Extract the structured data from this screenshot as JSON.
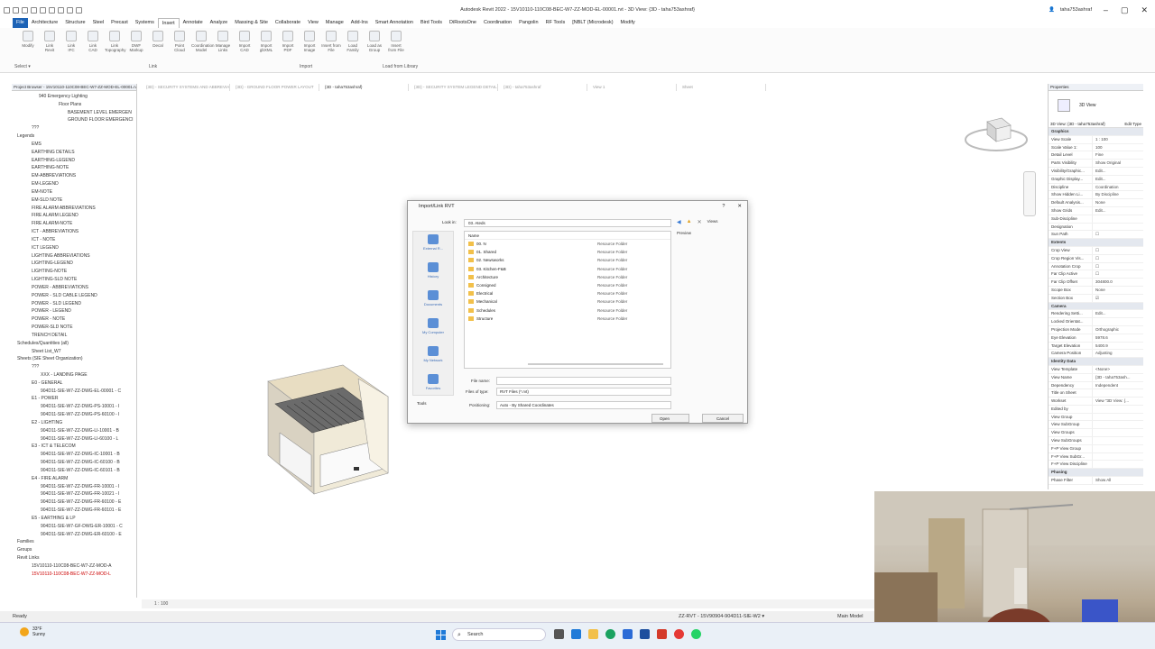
{
  "window": {
    "title": "Autodesk Revit 2022 - 15V10110-110C08-BEC-W7-ZZ-MOD-EL-00001.rvt - 3D View: {3D - taha753ashraf}",
    "user": "taha753ashraf",
    "controls": [
      "–",
      "▢",
      "✕"
    ]
  },
  "tabs": [
    "File",
    "Architecture",
    "Structure",
    "Steel",
    "Precast",
    "Systems",
    "Insert",
    "Annotate",
    "Analyze",
    "Massing & Site",
    "Collaborate",
    "View",
    "Manage",
    "Add-Ins",
    "Smart Annotation",
    "Bird Tools",
    "DiRootsOne",
    "Coordination",
    "Pangolin",
    "RF Tools",
    "[NBLT (Microdesk)",
    "Modify"
  ],
  "active_tab": "Insert",
  "ribbon": {
    "buttons": [
      [
        "Modify",
        ""
      ],
      [
        "Link",
        "Revit"
      ],
      [
        "Link",
        "IFC"
      ],
      [
        "Link",
        "CAD"
      ],
      [
        "Link",
        "Topography"
      ],
      [
        "DWF",
        "Markup"
      ],
      [
        "Decal",
        ""
      ],
      [
        "Point",
        "Cloud"
      ],
      [
        "Coordination",
        "Model"
      ],
      [
        "Manage",
        "Links"
      ],
      [
        "Import",
        "CAD"
      ],
      [
        "Import",
        "gbXML"
      ],
      [
        "Import",
        "PDF"
      ],
      [
        "Import",
        "Image"
      ],
      [
        "Insert from",
        "File"
      ],
      [
        "Load",
        "Family"
      ],
      [
        "Load as",
        "Group"
      ],
      [
        "Insert",
        "from File"
      ]
    ],
    "panels": [
      "Select",
      "Link",
      "Import",
      "Load from Library"
    ],
    "select": "Select ▾"
  },
  "view_tabs": [
    "{3D} - SECURITY SYSTEMS AND ABBREVIATIONS",
    "{3D} - GROUND FLOOR POWER LAYOUT",
    "{3D - taha753ashraf}",
    "{3D} - SECURITY SYSTEM LEGEND DETAIL",
    "{3D} - taha753ashraf",
    "View 1",
    "Sheet"
  ],
  "project_browser": {
    "title": "Project Browser - 15V10110-110C08-BEC-W7-ZZ-MOD-EL-00001.rvt",
    "items": [
      {
        "label": "940 Emergency Lighting",
        "indent": 30
      },
      {
        "label": "Floor Plans",
        "indent": 52
      },
      {
        "label": "BASEMENT LEVEL EMERGEN",
        "indent": 62
      },
      {
        "label": "GROUND FLOOR EMERGENCI",
        "indent": 62
      },
      {
        "label": "???",
        "indent": 22
      },
      {
        "label": "Legends",
        "indent": 6
      },
      {
        "label": "EMS",
        "indent": 22
      },
      {
        "label": "EARTHING DETAILS",
        "indent": 22
      },
      {
        "label": "EARTHING-LEGEND",
        "indent": 22
      },
      {
        "label": "EARTHING-NOTE",
        "indent": 22
      },
      {
        "label": "EM-ABBREVIATIONS",
        "indent": 22
      },
      {
        "label": "EM-LEGEND",
        "indent": 22
      },
      {
        "label": "EM-NOTE",
        "indent": 22
      },
      {
        "label": "EM-SLD NOTE",
        "indent": 22
      },
      {
        "label": "FIRE ALARM ABBREVIATIONS",
        "indent": 22
      },
      {
        "label": "FIRE ALARM LEGEND",
        "indent": 22
      },
      {
        "label": "FIRE ALARM-NOTE",
        "indent": 22
      },
      {
        "label": "ICT - ABBREVIATIONS",
        "indent": 22
      },
      {
        "label": "ICT - NOTE",
        "indent": 22
      },
      {
        "label": "ICT LEGEND",
        "indent": 22
      },
      {
        "label": "LIGHTING ABBREVIATIONS",
        "indent": 22
      },
      {
        "label": "LIGHTING-LEGEND",
        "indent": 22
      },
      {
        "label": "LIGHTING-NOTE",
        "indent": 22
      },
      {
        "label": "LIGHTING-SLD NOTE",
        "indent": 22
      },
      {
        "label": "POWER - ABBREVIATIONS",
        "indent": 22
      },
      {
        "label": "POWER - SLD CABLE LEGEND",
        "indent": 22
      },
      {
        "label": "POWER - SLD LEGEND",
        "indent": 22
      },
      {
        "label": "POWER - LEGEND",
        "indent": 22
      },
      {
        "label": "POWER - NOTE",
        "indent": 22
      },
      {
        "label": "POWER-SLD NOTE",
        "indent": 22
      },
      {
        "label": "TRENCH DETAIL",
        "indent": 22
      },
      {
        "label": "Schedules/Quantities (all)",
        "indent": 6
      },
      {
        "label": "Sheet List_W7",
        "indent": 22
      },
      {
        "label": "Sheets (SIE Sheet Organization)",
        "indent": 6
      },
      {
        "label": "???",
        "indent": 22
      },
      {
        "label": "XXX - LANDING PAGE",
        "indent": 32
      },
      {
        "label": "E0 - GENERAL",
        "indent": 22
      },
      {
        "label": "904D11-SIE-W7-ZZ-DWG-EL-00001 - C",
        "indent": 32
      },
      {
        "label": "E1 - POWER",
        "indent": 22
      },
      {
        "label": "904D11-SIE-W7-ZZ-DWG-PS-10001 - I",
        "indent": 32
      },
      {
        "label": "904D11-SIE-W7-ZZ-DWG-PS-60100 - I",
        "indent": 32
      },
      {
        "label": "E2 - LIGHTING",
        "indent": 22
      },
      {
        "label": "904D11-SIE-W7-ZZ-DWG-LI-10001 - B",
        "indent": 32
      },
      {
        "label": "904D11-SIE-W7-ZZ-DWG-LI-60100 - L",
        "indent": 32
      },
      {
        "label": "E3 - ICT & TELECOM",
        "indent": 22
      },
      {
        "label": "904D11-SIE-W7-ZZ-DWG-IC-10001 - B",
        "indent": 32
      },
      {
        "label": "904D11-SIE-W7-ZZ-DWG-IC-60100 - B",
        "indent": 32
      },
      {
        "label": "904D11-SIE-W7-ZZ-DWG-IC-60101 - B",
        "indent": 32
      },
      {
        "label": "E4 - FIRE ALARM",
        "indent": 22
      },
      {
        "label": "904D11-SIE-W7-ZZ-DWG-FR-10001 - I",
        "indent": 32
      },
      {
        "label": "904D11-SIE-W7-ZZ-DWG-FR-10021 - I",
        "indent": 32
      },
      {
        "label": "904D11-SIE-W7-ZZ-DWG-FR-60100 - E",
        "indent": 32
      },
      {
        "label": "904D11-SIE-W7-ZZ-DWG-FR-60101 - E",
        "indent": 32
      },
      {
        "label": "E5 - EARTHING & LP",
        "indent": 22
      },
      {
        "label": "904D11-SIE-W7-GF-DWG-ER-10001 - C",
        "indent": 32
      },
      {
        "label": "904D11-SIE-W7-ZZ-DWG-ER-60100 - E",
        "indent": 32
      },
      {
        "label": "Families",
        "indent": 6
      },
      {
        "label": "Groups",
        "indent": 6
      },
      {
        "label": "Revit Links",
        "indent": 6
      },
      {
        "label": "15V10110-110C08-BEC-W7-ZZ-MOD-A",
        "indent": 22
      },
      {
        "label": "15V10110-110C08-BEC-W7-ZZ-MOD-L",
        "indent": 22,
        "ref": true
      }
    ]
  },
  "properties": {
    "title": "Properties",
    "type": "3D View",
    "view_dropdown": "3D View: {3D - taha753ashraf}",
    "edit_type": "Edit Type",
    "rows": [
      {
        "k": "Graphics",
        "v": "",
        "cat": true
      },
      {
        "k": "View Scale",
        "v": "1 : 100"
      },
      {
        "k": "Scale Value  1:",
        "v": "100"
      },
      {
        "k": "Detail Level",
        "v": "Fine"
      },
      {
        "k": "Parts Visibility",
        "v": "Show Original"
      },
      {
        "k": "Visibility/Graphic...",
        "v": "Edit..."
      },
      {
        "k": "Graphic Display...",
        "v": "Edit..."
      },
      {
        "k": "Discipline",
        "v": "Coordination"
      },
      {
        "k": "Show Hidden Li...",
        "v": "By Discipline"
      },
      {
        "k": "Default Analysis...",
        "v": "None"
      },
      {
        "k": "Show Grids",
        "v": "Edit..."
      },
      {
        "k": "Sub-Discipline",
        "v": ""
      },
      {
        "k": "Designation",
        "v": ""
      },
      {
        "k": "Sun Path",
        "v": "☐"
      },
      {
        "k": "Extents",
        "v": "",
        "cat": true
      },
      {
        "k": "Crop View",
        "v": "☐"
      },
      {
        "k": "Crop Region Vis...",
        "v": "☐"
      },
      {
        "k": "Annotation Crop",
        "v": "☐"
      },
      {
        "k": "Far Clip Active",
        "v": "☐"
      },
      {
        "k": "Far Clip Offset",
        "v": "304800.0"
      },
      {
        "k": "Scope Box",
        "v": "None"
      },
      {
        "k": "Section Box",
        "v": "☑"
      },
      {
        "k": "Camera",
        "v": "",
        "cat": true
      },
      {
        "k": "Rendering Setti...",
        "v": "Edit..."
      },
      {
        "k": "Locked Orientat...",
        "v": ""
      },
      {
        "k": "Projection Mode",
        "v": "Orthographic"
      },
      {
        "k": "Eye Elevation",
        "v": "5978.6"
      },
      {
        "k": "Target Elevation",
        "v": "5400.9"
      },
      {
        "k": "Camera Position",
        "v": "Adjusting"
      },
      {
        "k": "Identity Data",
        "v": "",
        "cat": true
      },
      {
        "k": "View Template",
        "v": "<None>"
      },
      {
        "k": "View Name",
        "v": "{3D - taha753ash..."
      },
      {
        "k": "Dependency",
        "v": "Independent"
      },
      {
        "k": "Title on Sheet",
        "v": ""
      },
      {
        "k": "Workset",
        "v": "View \"3D View: {..."
      },
      {
        "k": "Edited by",
        "v": ""
      },
      {
        "k": "View Group",
        "v": ""
      },
      {
        "k": "View SubGroup",
        "v": ""
      },
      {
        "k": "View Groups",
        "v": ""
      },
      {
        "k": "View SubGroups",
        "v": ""
      },
      {
        "k": "F+P View Group",
        "v": ""
      },
      {
        "k": "F+P View SubGr...",
        "v": ""
      },
      {
        "k": "F+P View Discipline",
        "v": ""
      },
      {
        "k": "Phasing",
        "v": "",
        "cat": true
      },
      {
        "k": "Phase Filter",
        "v": "Show All"
      }
    ]
  },
  "dialog": {
    "title": "Import/Link RVT",
    "help": "?",
    "close": "✕",
    "look_in_label": "Look in:",
    "look_in": "03. Ateds",
    "views_label": "Views",
    "preview_label": "Preview",
    "name_header": "Name",
    "places": [
      "External R...",
      "History",
      "Documents",
      "My Computer",
      "My Network",
      "Favorites"
    ],
    "files": [
      {
        "name": "00. N",
        "type": "Resource Folder"
      },
      {
        "name": "01. Shared",
        "type": "Resource Folder"
      },
      {
        "name": "02. Newsworks",
        "type": "Resource Folder"
      },
      {
        "name": "03. Kitchen-F&B",
        "type": "Resource Folder"
      },
      {
        "name": "Architecture",
        "type": "Resource Folder"
      },
      {
        "name": "Consigned",
        "type": "Resource Folder"
      },
      {
        "name": "Electrical",
        "type": "Resource Folder"
      },
      {
        "name": "Mechanical",
        "type": "Resource Folder"
      },
      {
        "name": "Schedules",
        "type": "Resource Folder"
      },
      {
        "name": "Structure",
        "type": "Resource Folder"
      }
    ],
    "file_name_label": "File name:",
    "file_name": "",
    "files_of_type_label": "Files of type:",
    "files_of_type": "RVT Files  (*.rvt)",
    "positioning_label": "Positioning:",
    "positioning": "Auto - By Shared Coordinates",
    "tools": "Tools",
    "open": "Open",
    "cancel": "Cancel"
  },
  "status": {
    "left": "Ready",
    "view_scale": "1 : 100",
    "right_text": "ZZ-RVT - 15V90904-904D11-SIE-W2 ▾",
    "model": "Main Model"
  },
  "taskbar": {
    "temp": "33°F",
    "weather": "Sunny",
    "search": "Search"
  },
  "colors": {
    "file_tab": "#1d63b6",
    "folder": "#f2c04a",
    "accent": "#1f7ad8"
  }
}
